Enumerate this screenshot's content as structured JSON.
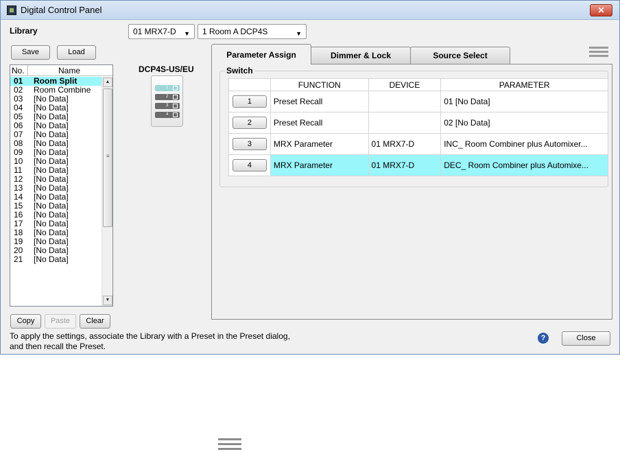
{
  "window": {
    "title": "Digital Control Panel",
    "close_glyph": "✕"
  },
  "library": {
    "label": "Library",
    "save_label": "Save",
    "load_label": "Load",
    "col_no": "No.",
    "col_name": "Name",
    "items": [
      {
        "no": "01",
        "name": "Room Split"
      },
      {
        "no": "02",
        "name": "Room Combine"
      },
      {
        "no": "03",
        "name": "[No Data]"
      },
      {
        "no": "04",
        "name": "[No Data]"
      },
      {
        "no": "05",
        "name": "[No Data]"
      },
      {
        "no": "06",
        "name": "[No Data]"
      },
      {
        "no": "07",
        "name": "[No Data]"
      },
      {
        "no": "08",
        "name": "[No Data]"
      },
      {
        "no": "09",
        "name": "[No Data]"
      },
      {
        "no": "10",
        "name": "[No Data]"
      },
      {
        "no": "11",
        "name": "[No Data]"
      },
      {
        "no": "12",
        "name": "[No Data]"
      },
      {
        "no": "13",
        "name": "[No Data]"
      },
      {
        "no": "14",
        "name": "[No Data]"
      },
      {
        "no": "15",
        "name": "[No Data]"
      },
      {
        "no": "16",
        "name": "[No Data]"
      },
      {
        "no": "17",
        "name": "[No Data]"
      },
      {
        "no": "18",
        "name": "[No Data]"
      },
      {
        "no": "19",
        "name": "[No Data]"
      },
      {
        "no": "20",
        "name": "[No Data]"
      },
      {
        "no": "21",
        "name": "[No Data]"
      }
    ],
    "copy_label": "Copy",
    "paste_label": "Paste",
    "clear_label": "Clear"
  },
  "selectors": {
    "mrx": "01 MRX7-D",
    "room": "1 Room A DCP4S"
  },
  "device": {
    "model": "DCP4S-US/EU",
    "buttons": [
      "1",
      "2",
      "3",
      "4"
    ]
  },
  "tabs": [
    "Parameter Assign",
    "Dimmer & Lock",
    "Source Select"
  ],
  "switch": {
    "label": "Switch",
    "headers": [
      "FUNCTION",
      "DEVICE",
      "PARAMETER"
    ],
    "rows": [
      {
        "num": "1",
        "function": "Preset Recall",
        "device": "",
        "parameter": "01 [No Data]"
      },
      {
        "num": "2",
        "function": "Preset Recall",
        "device": "",
        "parameter": "02 [No Data]"
      },
      {
        "num": "3",
        "function": "MRX Parameter",
        "device": "01 MRX7-D",
        "parameter": "INC_ Room Combiner plus Automixer..."
      },
      {
        "num": "4",
        "function": "MRX Parameter",
        "device": "01 MRX7-D",
        "parameter": "DEC_ Room Combiner plus Automixe..."
      }
    ]
  },
  "footer": {
    "info_line1": "To apply the settings, associate the Library with a Preset in the Preset dialog,",
    "info_line2": "and then recall the Preset.",
    "help_glyph": "?",
    "close_label": "Close"
  },
  "colors": {
    "selection": "#99f7fb",
    "title_bar": "#c4d7ee"
  }
}
